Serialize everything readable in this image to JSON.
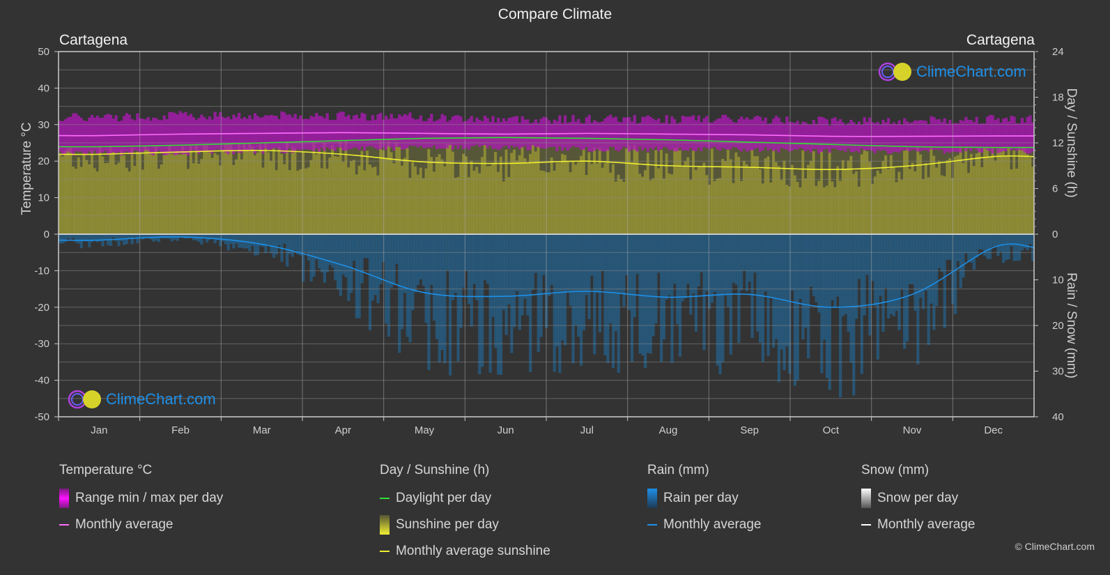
{
  "title": "Compare Climate",
  "city_left": "Cartagena",
  "city_right": "Cartagena",
  "logo_text": "ClimeChart.com",
  "copyright": "© ClimeChart.com",
  "colors": {
    "background": "#333333",
    "temp_range": "#b01ab8",
    "temp_avg": "#ff6dff",
    "daylight": "#33dd33",
    "sunshine_fill": "#8c8a35",
    "sunshine_avg": "#f0f032",
    "rain_fill": "#1f6fa8",
    "rain_avg": "#1e90e8",
    "snow_avg": "#ffffff"
  },
  "chart_data": {
    "type": "area",
    "title": "Compare Climate",
    "categories": [
      "Jan",
      "Feb",
      "Mar",
      "Apr",
      "May",
      "Jun",
      "Jul",
      "Aug",
      "Sep",
      "Oct",
      "Nov",
      "Dec"
    ],
    "left_axis": {
      "label": "Temperature °C",
      "range": [
        -50,
        50
      ],
      "ticks": [
        50,
        40,
        30,
        20,
        10,
        0,
        -10,
        -20,
        -30,
        -40,
        -50
      ]
    },
    "right_axis_top": {
      "label": "Day / Sunshine (h)",
      "range": [
        0,
        24
      ],
      "ticks": [
        24,
        18,
        12,
        6,
        0
      ]
    },
    "right_axis_bottom": {
      "label": "Rain / Snow (mm)",
      "range": [
        0,
        40
      ],
      "ticks": [
        0,
        10,
        20,
        30,
        40
      ]
    },
    "grid": true,
    "series": [
      {
        "name": "Temperature range max per day",
        "axis": "temperature",
        "values": [
          31.5,
          32.0,
          32.0,
          32.0,
          31.5,
          31.0,
          31.0,
          31.0,
          31.0,
          30.5,
          30.5,
          31.0
        ]
      },
      {
        "name": "Temperature range min per day",
        "axis": "temperature",
        "values": [
          23.0,
          23.0,
          23.5,
          24.0,
          24.5,
          24.5,
          24.0,
          24.0,
          24.0,
          23.5,
          23.5,
          23.5
        ]
      },
      {
        "name": "Temperature monthly average",
        "axis": "temperature",
        "values": [
          27.0,
          27.4,
          27.6,
          27.8,
          27.6,
          27.4,
          27.6,
          27.4,
          27.2,
          26.8,
          26.8,
          26.9
        ]
      },
      {
        "name": "Daylight per day",
        "axis": "sunshine",
        "values": [
          11.5,
          11.7,
          12.0,
          12.3,
          12.6,
          12.7,
          12.6,
          12.4,
          12.1,
          11.8,
          11.5,
          11.4
        ]
      },
      {
        "name": "Monthly average sunshine",
        "axis": "sunshine",
        "values": [
          10.5,
          10.8,
          11.0,
          10.5,
          9.5,
          9.3,
          9.6,
          9.0,
          8.8,
          8.5,
          9.0,
          10.2
        ]
      },
      {
        "name": "Rain monthly average",
        "axis": "rain",
        "values": [
          1.3,
          0.6,
          2.2,
          6.8,
          12.8,
          13.6,
          12.5,
          13.8,
          13.2,
          16.0,
          13.2,
          2.9
        ]
      },
      {
        "name": "Snow monthly average",
        "axis": "rain",
        "values": [
          0,
          0,
          0,
          0,
          0,
          0,
          0,
          0,
          0,
          0,
          0,
          0
        ]
      }
    ]
  },
  "legend": {
    "temperature": {
      "heading": "Temperature °C",
      "items": [
        "Range min / max per day",
        "Monthly average"
      ]
    },
    "sunshine": {
      "heading": "Day / Sunshine (h)",
      "items": [
        "Daylight per day",
        "Sunshine per day",
        "Monthly average sunshine"
      ]
    },
    "rain": {
      "heading": "Rain (mm)",
      "items": [
        "Rain per day",
        "Monthly average"
      ]
    },
    "snow": {
      "heading": "Snow (mm)",
      "items": [
        "Snow per day",
        "Monthly average"
      ]
    }
  }
}
